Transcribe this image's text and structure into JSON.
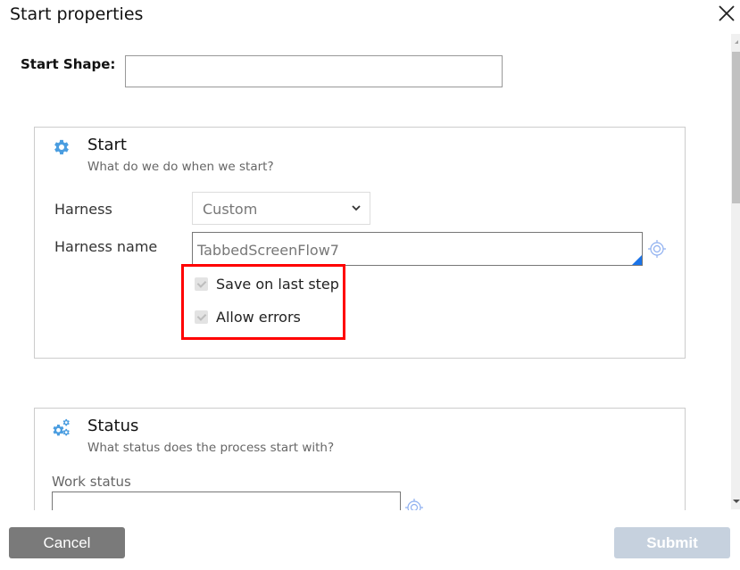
{
  "dialog": {
    "title": "Start properties",
    "close_icon": "close-icon"
  },
  "start_shape": {
    "label": "Start Shape:",
    "value": ""
  },
  "start_section": {
    "icon": "gear-icon",
    "title": "Start",
    "subtitle": "What do we do when we start?",
    "harness_label": "Harness",
    "harness_value": "Custom",
    "harness_name_label": "Harness name",
    "harness_name_value": "TabbedScreenFlow7",
    "target_icon": "crosshair-icon",
    "checkboxes": [
      {
        "label": "Save on last step",
        "checked": true,
        "disabled": true
      },
      {
        "label": "Allow errors",
        "checked": true,
        "disabled": true
      }
    ],
    "highlight_color": "#ff0000"
  },
  "status_section": {
    "icon": "gears-icon",
    "title": "Status",
    "subtitle": "What status does the process start with?",
    "work_status_label": "Work status",
    "work_status_value": ""
  },
  "footer": {
    "cancel_label": "Cancel",
    "submit_label": "Submit",
    "cancel_color": "#7a7a7a",
    "submit_color": "#c6d1de"
  },
  "colors": {
    "accent": "#1a73e8",
    "icon_blue": "#4a9de0"
  }
}
